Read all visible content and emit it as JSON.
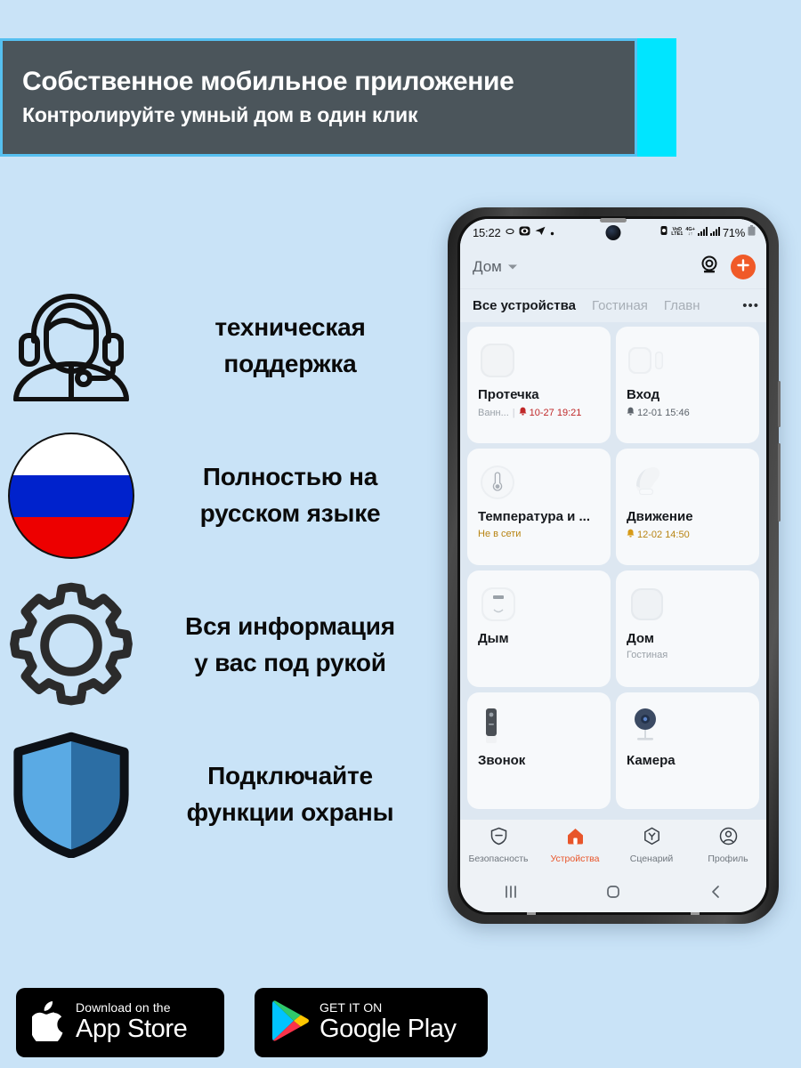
{
  "theme": {
    "page_bg": "#c9e3f7",
    "banner_border": "#56c0f0",
    "banner_dark": "#4b555b",
    "banner_accent": "#00e5ff",
    "brand_orange": "#f05a28",
    "alarm_red": "#c02828",
    "offline_amber": "#b88412"
  },
  "header": {
    "title": "Собственное мобильное приложение",
    "subtitle": "Контролируйте умный дом в один клик"
  },
  "features": [
    {
      "icon": "headset-support-icon",
      "label": "техническая\nподдержка"
    },
    {
      "icon": "russian-flag-icon",
      "label": "Полностью на\nрусском языке"
    },
    {
      "icon": "gear-icon",
      "label": "Вся информация\nу вас под рукой"
    },
    {
      "icon": "shield-icon",
      "label": "Подключайте\nфункции охраны"
    }
  ],
  "phone": {
    "status_bar": {
      "time": "15:22",
      "left_icons": [
        "ring-icon",
        "eye-capsule-icon",
        "telegram-icon",
        "dot-icon"
      ],
      "right_icons": [
        "alarm-vibrate-icon",
        "volte-icon",
        "4gplus-icon",
        "signal-bars-icon",
        "signal-bars-icon"
      ],
      "volte_top": "VoD",
      "volte_bottom": "LTE1",
      "net_top": "4G+",
      "net_bottom": "↓↑",
      "battery_percent": "71%",
      "battery_icon": "battery-icon"
    },
    "app_header": {
      "home_label": "Дом",
      "dropdown_icon": "chevron-down-icon",
      "camera_icon": "camera-view-icon",
      "add_icon": "plus-icon"
    },
    "tabs": [
      {
        "label": "Все устройства",
        "active": true
      },
      {
        "label": "Гостиная",
        "active": false
      },
      {
        "label": "Главн",
        "active": false
      }
    ],
    "tabs_more": "•••",
    "devices": [
      {
        "name": "Протечка",
        "art": "leak-sensor-art",
        "room": "Ванн...",
        "separator": "|",
        "alarm_icon": "bell-icon",
        "alarm_time": "10-27 19:21",
        "alarm_style": "red"
      },
      {
        "name": "Вход",
        "art": "door-sensor-art",
        "room": "",
        "separator": "",
        "alarm_icon": "bell-icon",
        "alarm_time": "12-01 15:46",
        "alarm_style": "gray"
      },
      {
        "name": "Температура и ...",
        "art": "temp-sensor-art",
        "status": "Не в сети",
        "status_style": "offline"
      },
      {
        "name": "Движение",
        "art": "motion-sensor-art",
        "alarm_icon": "bell-icon",
        "alarm_time": "12-02 14:50",
        "alarm_style": "amber"
      },
      {
        "name": "Дым",
        "art": "smoke-sensor-art"
      },
      {
        "name": "Дом",
        "art": "hub-art",
        "room": "Гостиная"
      },
      {
        "name": "Звонок",
        "art": "doorbell-art"
      },
      {
        "name": "Камера",
        "art": "camera-art"
      }
    ],
    "bottom_nav": [
      {
        "label": "Безопасность",
        "icon": "shield-minus-icon",
        "active": false
      },
      {
        "label": "Устройства",
        "icon": "home-icon",
        "active": true
      },
      {
        "label": "Сценарий",
        "icon": "hexagon-y-icon",
        "active": false
      },
      {
        "label": "Профиль",
        "icon": "person-circle-icon",
        "active": false
      }
    ],
    "gesture_bar": [
      {
        "icon": "recents-icon"
      },
      {
        "icon": "home-square-icon"
      },
      {
        "icon": "back-icon"
      }
    ]
  },
  "store_badges": [
    {
      "icon": "apple-icon",
      "small": "Download on the",
      "big": "App Store"
    },
    {
      "icon": "google-play-icon",
      "small": "GET IT ON",
      "big": "Google Play"
    }
  ]
}
